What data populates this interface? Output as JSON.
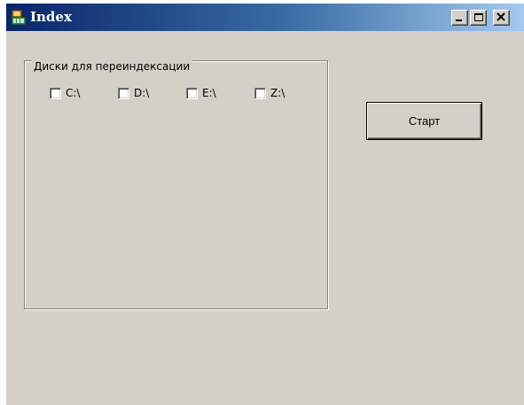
{
  "window": {
    "title": "Index",
    "title_gradient": [
      "#0a246a",
      "#a6caf0"
    ],
    "background": "#d4d0c8",
    "caption_buttons": [
      "minimize-icon",
      "maximize-icon",
      "close-icon"
    ]
  },
  "group": {
    "legend": "Диски для переиндексации",
    "drives": [
      {
        "label": "C:\\",
        "checked": false
      },
      {
        "label": "D:\\",
        "checked": false
      },
      {
        "label": "E:\\",
        "checked": false
      },
      {
        "label": "Z:\\",
        "checked": false
      }
    ]
  },
  "actions": {
    "start_label": "Старт"
  }
}
